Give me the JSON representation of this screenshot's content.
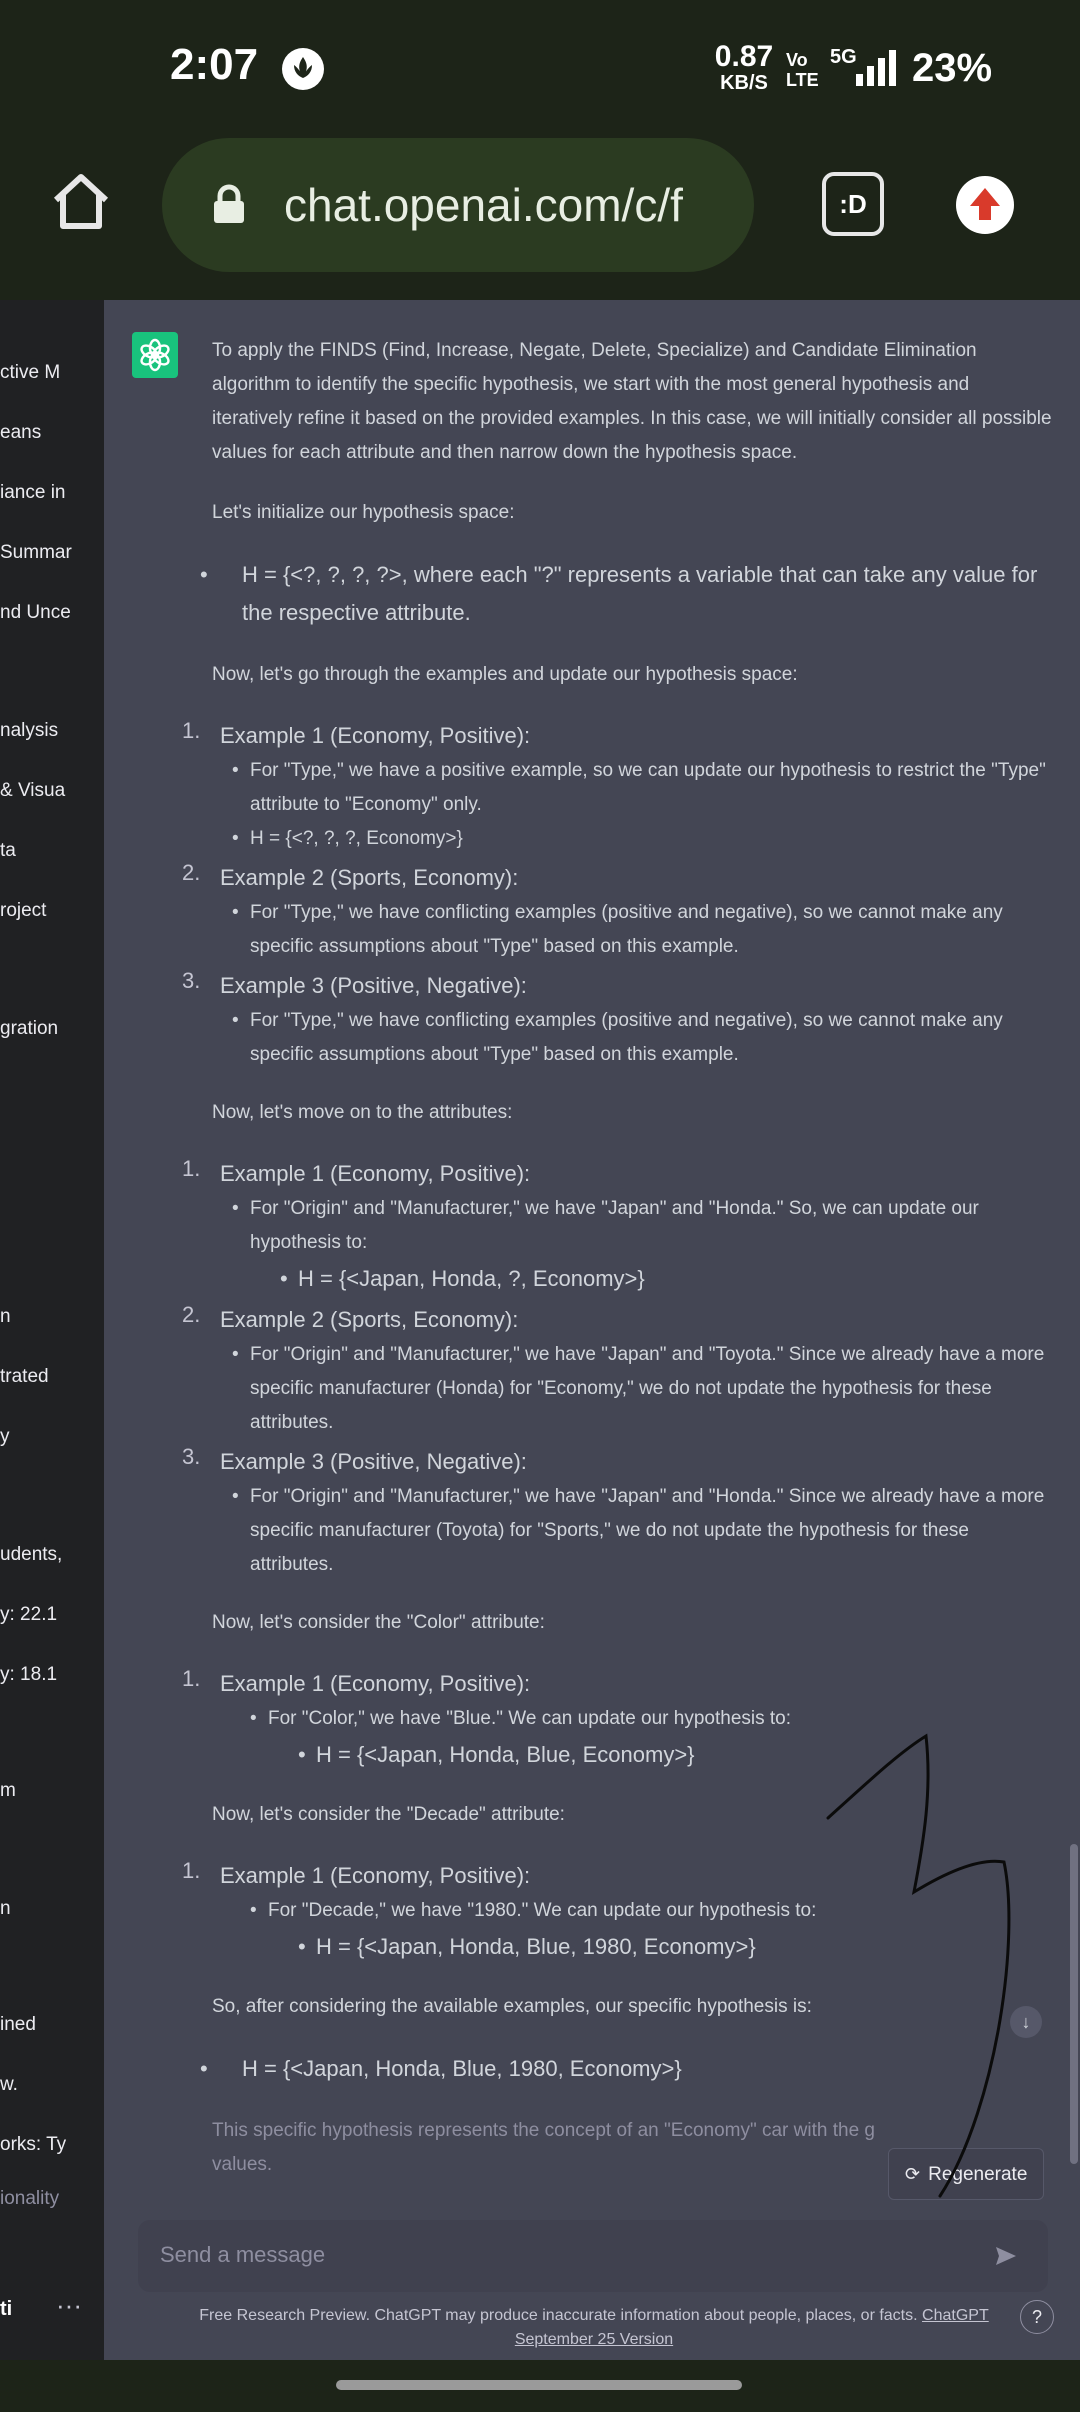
{
  "status_bar": {
    "time": "2:07",
    "speed_value": "0.87",
    "speed_unit": "KB/S",
    "volte": "Vo\nLTE",
    "network": "5G",
    "battery": "23%"
  },
  "browser": {
    "url": "chat.openai.com/c/f",
    "tabs_label": ":D",
    "home_icon": "home-icon",
    "lock_icon": "lock-icon",
    "update_icon": "arrow-up-icon"
  },
  "sidebar": {
    "items": [
      "ctive M",
      "eans",
      "iance in",
      "Summar",
      "nd Unce",
      "nalysis",
      "& Visua",
      "ta",
      "roject",
      "gration",
      "n",
      "trated",
      "y",
      "udents,",
      "y: 22.1",
      "y: 18.1",
      "m",
      "n",
      "ined",
      "w.",
      "orks: Ty",
      "ionality"
    ],
    "user_initials": "ti",
    "menu_label": "···"
  },
  "chat": {
    "intro": "To apply the FINDS (Find, Increase, Negate, Delete, Specialize) and Candidate Elimination algorithm to identify the specific hypothesis, we start with the most general hypothesis and iteratively refine it based on the provided examples. In this case, we will initially consider all possible values for each attribute and then narrow down the hypothesis space.",
    "init": "Let's initialize our hypothesis space:",
    "h_general": "H = {<?, ?, ?, ?>, where each \"?\" represents a variable that can take any value for the respective attribute.",
    "go_through": "Now, let's go through the examples and update our hypothesis space:",
    "type_section": [
      {
        "num": "1.",
        "head": "Example 1 (Economy, Positive):",
        "subs": [
          "For \"Type,\" we have a positive example, so we can update our hypothesis to restrict the \"Type\" attribute to \"Economy\" only.",
          "H = {<?, ?, ?, Economy>}"
        ]
      },
      {
        "num": "2.",
        "head": "Example 2 (Sports, Economy):",
        "subs": [
          "For \"Type,\" we have conflicting examples (positive and negative), so we cannot make any specific assumptions about \"Type\" based on this example."
        ]
      },
      {
        "num": "3.",
        "head": "Example 3 (Positive, Negative):",
        "subs": [
          "For \"Type,\" we have conflicting examples (positive and negative), so we cannot make any specific assumptions about \"Type\" based on this example."
        ]
      }
    ],
    "attributes": "Now, let's move on to the attributes:",
    "attr_section": [
      {
        "num": "1.",
        "head": "Example 1 (Economy, Positive):",
        "sub": "For \"Origin\" and \"Manufacturer,\" we have \"Japan\" and \"Honda.\" So, we can update our hypothesis to:",
        "sub2": "H = {<Japan, Honda, ?, Economy>}"
      },
      {
        "num": "2.",
        "head": "Example 2 (Sports, Economy):",
        "sub": "For \"Origin\" and \"Manufacturer,\" we have \"Japan\" and \"Toyota.\" Since we already have a more specific manufacturer (Honda) for \"Economy,\" we do not update the hypothesis for these attributes."
      },
      {
        "num": "3.",
        "head": "Example 3 (Positive, Negative):",
        "sub": "For \"Origin\" and \"Manufacturer,\" we have \"Japan\" and \"Honda.\" Since we already have a more specific manufacturer (Toyota) for \"Sports,\" we do not update the hypothesis for these attributes."
      }
    ],
    "color_intro": "Now, let's consider the \"Color\" attribute:",
    "color_head": "Example 1 (Economy, Positive):",
    "color_sub": "For \"Color,\" we have \"Blue.\" We can update our hypothesis to:",
    "color_h": "H = {<Japan, Honda, Blue, Economy>}",
    "decade_intro": "Now, let's consider the \"Decade\" attribute:",
    "decade_head": "Example 1 (Economy, Positive):",
    "decade_sub": "For \"Decade,\" we have \"1980.\" We can update our hypothesis to:",
    "decade_h": "H = {<Japan, Honda, Blue, 1980, Economy>}",
    "so_after": "So, after considering the available examples, our specific hypothesis is:",
    "final_h": "H = {<Japan, Honda, Blue, 1980, Economy>}",
    "closing": "This specific hypothesis represents the concept of an \"Economy\" car with the g",
    "closing_2": "values."
  },
  "controls": {
    "regenerate": "Regenerate",
    "scroll_down": "↓",
    "input_placeholder": "Send a message",
    "help": "?"
  },
  "footer": {
    "text": "Free Research Preview. ChatGPT may produce inaccurate information about people, places, or facts.",
    "link_1": "ChatGPT",
    "link_2": "September 25 Version"
  },
  "colors": {
    "accent_green": "#19c37d",
    "main_bg": "#444654",
    "sidebar_bg": "#202123",
    "browser_bg": "#1d2418",
    "update_red": "#d93a2b"
  }
}
